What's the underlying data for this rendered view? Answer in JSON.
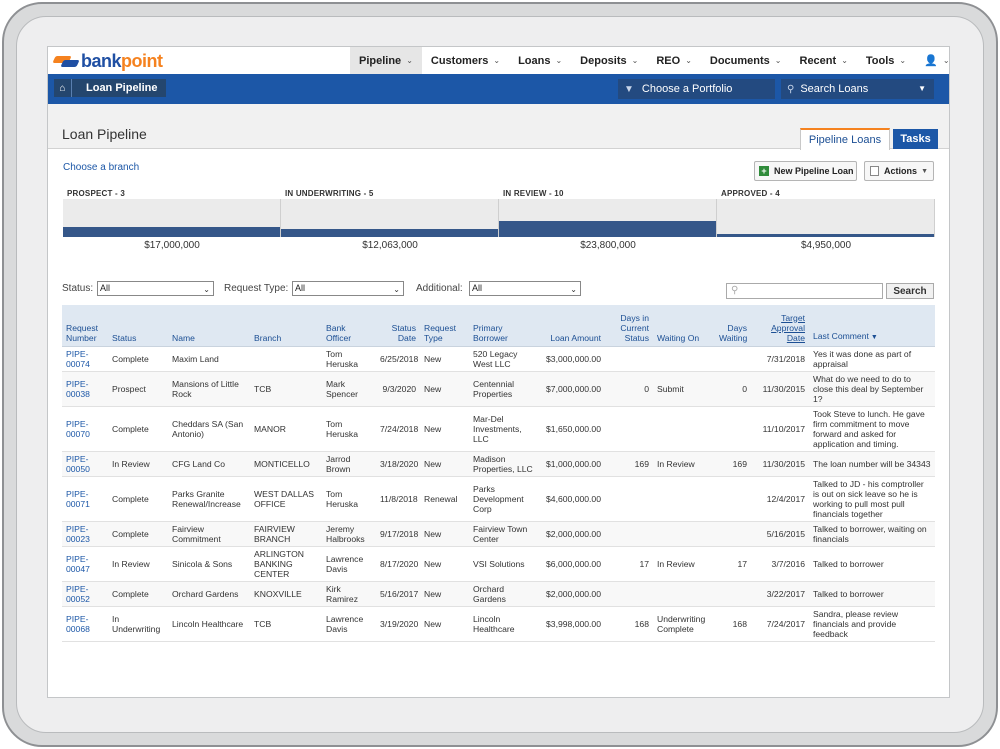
{
  "brand": {
    "name_main": "bank",
    "name_accent": "point"
  },
  "nav": {
    "menus": [
      {
        "label": "Pipeline",
        "active": true
      },
      {
        "label": "Customers"
      },
      {
        "label": "Loans"
      },
      {
        "label": "Deposits"
      },
      {
        "label": "REO"
      },
      {
        "label": "Documents"
      },
      {
        "label": "Recent"
      },
      {
        "label": "Tools"
      },
      {
        "label": "👤"
      }
    ]
  },
  "breadcrumb": {
    "label": "Loan Pipeline"
  },
  "portfolio": {
    "label": "Choose a Portfolio"
  },
  "search_loans": {
    "label": "Search Loans"
  },
  "page": {
    "title": "Loan Pipeline",
    "tabs": {
      "pipeline": "Pipeline Loans",
      "tasks": "Tasks"
    },
    "branch_link": "Choose a branch",
    "new_button": "New Pipeline Loan",
    "actions_button": "Actions"
  },
  "stages": [
    {
      "label": "PROSPECT - 3",
      "amount": "$17,000,000",
      "level": 0.26
    },
    {
      "label": "IN UNDERWRITING - 5",
      "amount": "$12,063,000",
      "level": 0.2
    },
    {
      "label": "IN REVIEW - 10",
      "amount": "$23,800,000",
      "level": 0.42
    },
    {
      "label": "APPROVED - 4",
      "amount": "$4,950,000",
      "level": 0.08
    }
  ],
  "filters": {
    "status_label": "Status:",
    "status_value": "All",
    "request_type_label": "Request Type:",
    "request_type_value": "All",
    "additional_label": "Additional:",
    "additional_value": "All",
    "search_button": "Search"
  },
  "table": {
    "headers": [
      "Request Number",
      "Status",
      "Name",
      "Branch",
      "Bank Officer",
      "Status Date",
      "Request Type",
      "Primary Borrower",
      "Loan Amount",
      "Days in Current Status",
      "Waiting On",
      "Days Waiting",
      "Target Approval Date",
      "Last Comment"
    ],
    "rows": [
      [
        "PIPE-00074",
        "Complete",
        "Maxim Land",
        "",
        "Tom Heruska",
        "6/25/2018",
        "New",
        "520 Legacy West LLC",
        "$3,000,000.00",
        "",
        "",
        "",
        "7/31/2018",
        "Yes it was done as part of appraisal"
      ],
      [
        "PIPE-00038",
        "Prospect",
        "Mansions of Little Rock",
        "TCB",
        "Mark Spencer",
        "9/3/2020",
        "New",
        "Centennial Properties",
        "$7,000,000.00",
        "0",
        "Submit",
        "0",
        "11/30/2015",
        "What do we need to do to close this deal by September 1?"
      ],
      [
        "PIPE-00070",
        "Complete",
        "Cheddars SA (San Antonio)",
        "MANOR",
        "Tom Heruska",
        "7/24/2018",
        "New",
        "Mar-Del Investments, LLC",
        "$1,650,000.00",
        "",
        "",
        "",
        "11/10/2017",
        "Took Steve to lunch. He gave firm commitment to move forward and asked for application and timing."
      ],
      [
        "PIPE-00050",
        "In Review",
        "CFG Land Co",
        "MONTICELLO",
        "Jarrod Brown",
        "3/18/2020",
        "New",
        "Madison Properties, LLC",
        "$1,000,000.00",
        "169",
        "In Review",
        "169",
        "11/30/2015",
        "The loan number will be 34343"
      ],
      [
        "PIPE-00071",
        "Complete",
        "Parks Granite Renewal/Increase",
        "WEST DALLAS OFFICE",
        "Tom Heruska",
        "11/8/2018",
        "Renewal",
        "Parks Development Corp",
        "$4,600,000.00",
        "",
        "",
        "",
        "12/4/2017",
        "Talked to JD - his comptroller is out on sick leave so he is working to pull most pull financials together"
      ],
      [
        "PIPE-00023",
        "Complete",
        "Fairview Commitment",
        "FAIRVIEW BRANCH",
        "Jeremy Halbrooks",
        "9/17/2018",
        "New",
        "Fairview Town Center",
        "$2,000,000.00",
        "",
        "",
        "",
        "5/16/2015",
        "Talked to borrower, waiting on financials"
      ],
      [
        "PIPE-00047",
        "In Review",
        "Sinicola & Sons",
        "ARLINGTON BANKING CENTER",
        "Lawrence Davis",
        "8/17/2020",
        "New",
        "VSI Solutions",
        "$6,000,000.00",
        "17",
        "In Review",
        "17",
        "3/7/2016",
        "Talked to borrower"
      ],
      [
        "PIPE-00052",
        "Complete",
        "Orchard Gardens",
        "KNOXVILLE",
        "Kirk Ramirez",
        "5/16/2017",
        "New",
        "Orchard Gardens",
        "$2,000,000.00",
        "",
        "",
        "",
        "3/22/2017",
        "Talked to borrower"
      ],
      [
        "PIPE-00068",
        "In Underwriting",
        "Lincoln Healthcare",
        "TCB",
        "Lawrence Davis",
        "3/19/2020",
        "New",
        "Lincoln Healthcare",
        "$3,998,000.00",
        "168",
        "Underwriting Complete",
        "168",
        "7/24/2017",
        "Sandra, please review financials and provide feedback"
      ]
    ]
  },
  "colors": {
    "brand_blue": "#1c57a7",
    "brand_orange": "#f5821f",
    "stage_fill": "#355789"
  }
}
